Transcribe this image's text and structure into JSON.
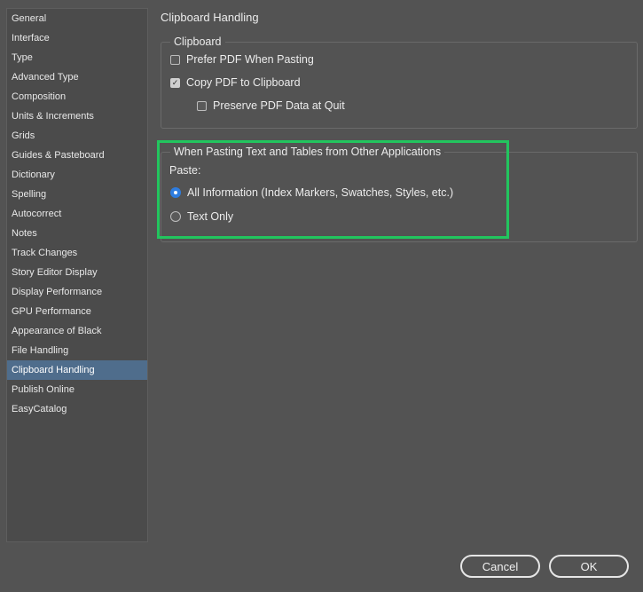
{
  "sidebar": {
    "items": [
      {
        "label": "General"
      },
      {
        "label": "Interface"
      },
      {
        "label": "Type"
      },
      {
        "label": "Advanced Type"
      },
      {
        "label": "Composition"
      },
      {
        "label": "Units & Increments"
      },
      {
        "label": "Grids"
      },
      {
        "label": "Guides & Pasteboard"
      },
      {
        "label": "Dictionary"
      },
      {
        "label": "Spelling"
      },
      {
        "label": "Autocorrect"
      },
      {
        "label": "Notes"
      },
      {
        "label": "Track Changes"
      },
      {
        "label": "Story Editor Display"
      },
      {
        "label": "Display Performance"
      },
      {
        "label": "GPU Performance"
      },
      {
        "label": "Appearance of Black"
      },
      {
        "label": "File Handling"
      },
      {
        "label": "Clipboard Handling",
        "selected": true
      },
      {
        "label": "Publish Online"
      },
      {
        "label": "EasyCatalog"
      }
    ]
  },
  "panel": {
    "title": "Clipboard Handling",
    "clipboard_group": {
      "legend": "Clipboard",
      "prefer_pdf": {
        "label": "Prefer PDF When Pasting",
        "checked": false
      },
      "copy_pdf": {
        "label": "Copy PDF to Clipboard",
        "checked": true
      },
      "preserve_pdf": {
        "label": "Preserve PDF Data at Quit",
        "checked": false
      }
    },
    "pasting_group": {
      "legend": "When Pasting Text and Tables from Other Applications",
      "paste_label": "Paste:",
      "all_information": {
        "label": "All Information (Index Markers, Swatches, Styles, etc.)",
        "selected": true
      },
      "text_only": {
        "label": "Text Only",
        "selected": false
      }
    }
  },
  "buttons": {
    "cancel": "Cancel",
    "ok": "OK"
  },
  "colors": {
    "background": "#535353",
    "sidebar_selected": "#4f6d8c",
    "radio_accent": "#2e7de0",
    "highlight_border": "#22c55e"
  }
}
